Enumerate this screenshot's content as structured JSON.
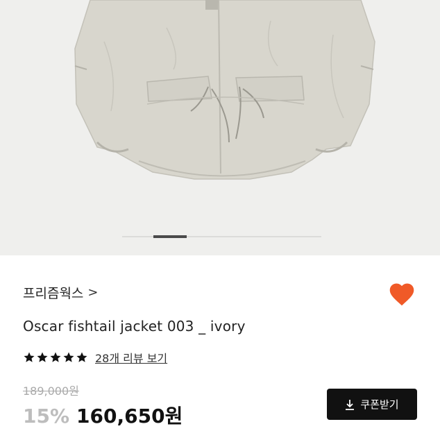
{
  "product": {
    "brand_label": "프리즘웍스",
    "brand_chevron": ">",
    "title": "Oscar fishtail jacket 003 _ ivory",
    "rating_stars": 5,
    "review_link": "28개 리뷰 보기",
    "original_price": "189,000원",
    "discount": "15%",
    "sale_price": "160,650원",
    "liked": true
  },
  "coupon_button": {
    "label": "쿠폰받기",
    "icon": "download-icon"
  },
  "gallery": {
    "slide_count": 6,
    "active_slide": 2
  },
  "colors": {
    "heart": "#f05a28",
    "button_bg": "#111111",
    "gallery_bg": "#efefed",
    "jacket": "#d8d6cd"
  }
}
